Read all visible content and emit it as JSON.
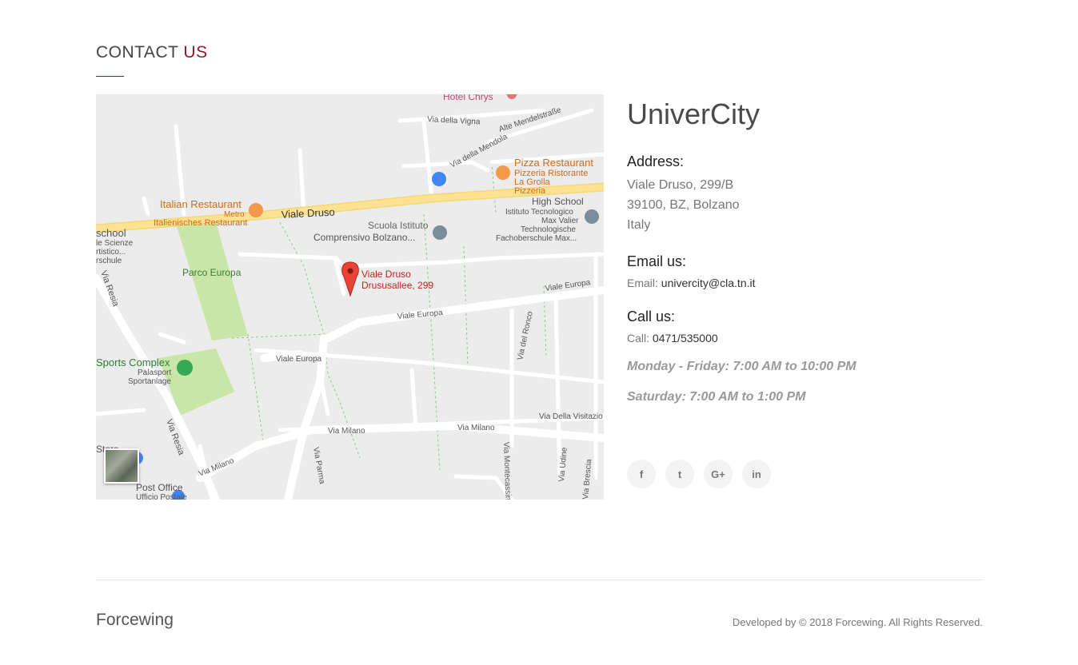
{
  "header": {
    "title_main": "CONTACT",
    "title_accent": "US"
  },
  "map": {
    "labels": {
      "hotel": "Hotel Chrys",
      "via_della_vigna": "Via della Vigna",
      "alte_mendelstrasse": "Alte Mendelstraße",
      "via_della_mendola": "Via della Mendola",
      "pizza_1": "Pizza Restaurant",
      "pizza_2": "Pizzeria Ristorante",
      "pizza_3": "La Grolla",
      "pizza_4": "Pizzeria",
      "italian_1": "Italian Restaurant",
      "italian_2": "Metro",
      "italian_3": "Italienisches Restaurant",
      "viale_druso": "Viale Druso",
      "school_1": "Scuola Istituto",
      "school_2": "Comprensivo Bolzano...",
      "high_1": "High School",
      "high_2": "Istituto Tecnologico",
      "high_3": "Max Valier",
      "high_4": "Technologische",
      "high_5": "Fachoberschule Max...",
      "left_1": "school",
      "left_2": "le Scienze",
      "left_3": "rtistico...",
      "left_4": "rschule",
      "parco": "Parco Europa",
      "pin_1": "Viale Druso",
      "pin_2": "Drususallee, 299",
      "viale_europa_1": "Viale Europa",
      "viale_europa_2": "Viale Europa",
      "viale_europa_3": "Viale Europa",
      "via_resia_1": "Via Resia",
      "via_resia_2": "Via Resia",
      "sports_1": "Sports Complex",
      "sports_2": "Palasport",
      "sports_3": "Sportanlage",
      "via_del_ronco": "Via del Ronco",
      "via_della_visitazione": "Via Della Visitazio",
      "via_milano_1": "Via Milano",
      "via_milano_2": "Via Milano",
      "via_milano_3": "Via Milano",
      "via_parma": "Via Parma",
      "via_montecassino": "Via Montecassino",
      "via_udine": "Via Udine",
      "via_brescia": "Via Brescia",
      "store": "Store",
      "post_1": "Post Office",
      "post_2": "Ufficio Postale"
    }
  },
  "info": {
    "title": "UniverCity",
    "address_heading": "Address:",
    "address_line1": "Viale Druso, 299/B",
    "address_line2": "39100, BZ, Bolzano",
    "address_line3": "Italy",
    "email_heading": "Email us:",
    "email_label": "Email:",
    "email_value": "univercity@cla.tn.it",
    "call_heading": "Call us:",
    "call_label": "Call:",
    "call_value": "0471/535000",
    "hours_week": "Monday - Friday: 7:00 AM to 10:00 PM",
    "hours_sat": "Saturday: 7:00 AM to 1:00 PM"
  },
  "socials": [
    {
      "icon": "facebook-icon",
      "glyph": "f"
    },
    {
      "icon": "twitter-icon",
      "glyph": "t"
    },
    {
      "icon": "google-plus-icon",
      "glyph": "G+"
    },
    {
      "icon": "linkedin-icon",
      "glyph": "in"
    }
  ],
  "footer": {
    "brand": "Forcewing",
    "copyright": "Developed by © 2018 Forcewing. All Rights Reserved."
  },
  "colors": {
    "accent": "#8b1c2c",
    "road_major": "#fde293",
    "park": "#c8e6a8",
    "pin": "#ea4335"
  }
}
